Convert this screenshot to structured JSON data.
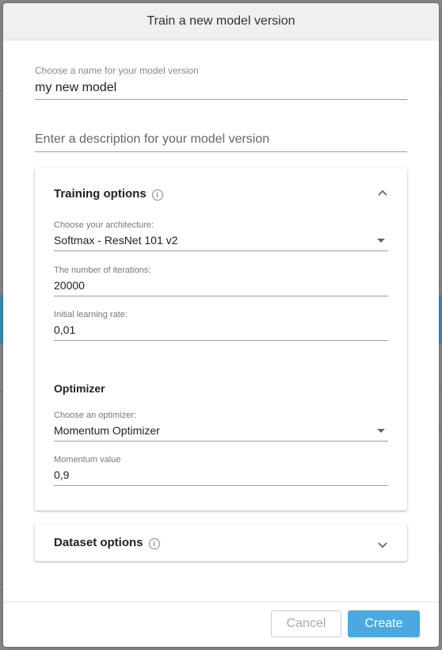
{
  "dialog": {
    "title": "Train a new model version"
  },
  "name_field": {
    "label": "Choose a name for your model version",
    "value": "my new model"
  },
  "description_field": {
    "placeholder": "Enter a description for your model version"
  },
  "training_options": {
    "title": "Training options",
    "expanded": true,
    "architecture": {
      "label": "Choose your architecture:",
      "value": "Softmax - ResNet 101 v2"
    },
    "iterations": {
      "label": "The number of iterations:",
      "value": "20000"
    },
    "learning_rate": {
      "label": "Initial learning rate:",
      "value": "0,01"
    },
    "optimizer_section": {
      "title": "Optimizer",
      "optimizer": {
        "label": "Choose an optimizer:",
        "value": "Momentum Optimizer"
      },
      "momentum": {
        "label": "Momentum value",
        "value": "0,9"
      }
    }
  },
  "dataset_options": {
    "title": "Dataset options",
    "expanded": false
  },
  "footer": {
    "cancel_label": "Cancel",
    "create_label": "Create"
  },
  "colors": {
    "primary": "#4aa9e0",
    "header_bg": "#f0f0f0"
  },
  "icons": {
    "info": "info-icon",
    "collapse": "chevron-up-icon",
    "expand": "chevron-down-icon",
    "dropdown": "caret-down-icon"
  }
}
